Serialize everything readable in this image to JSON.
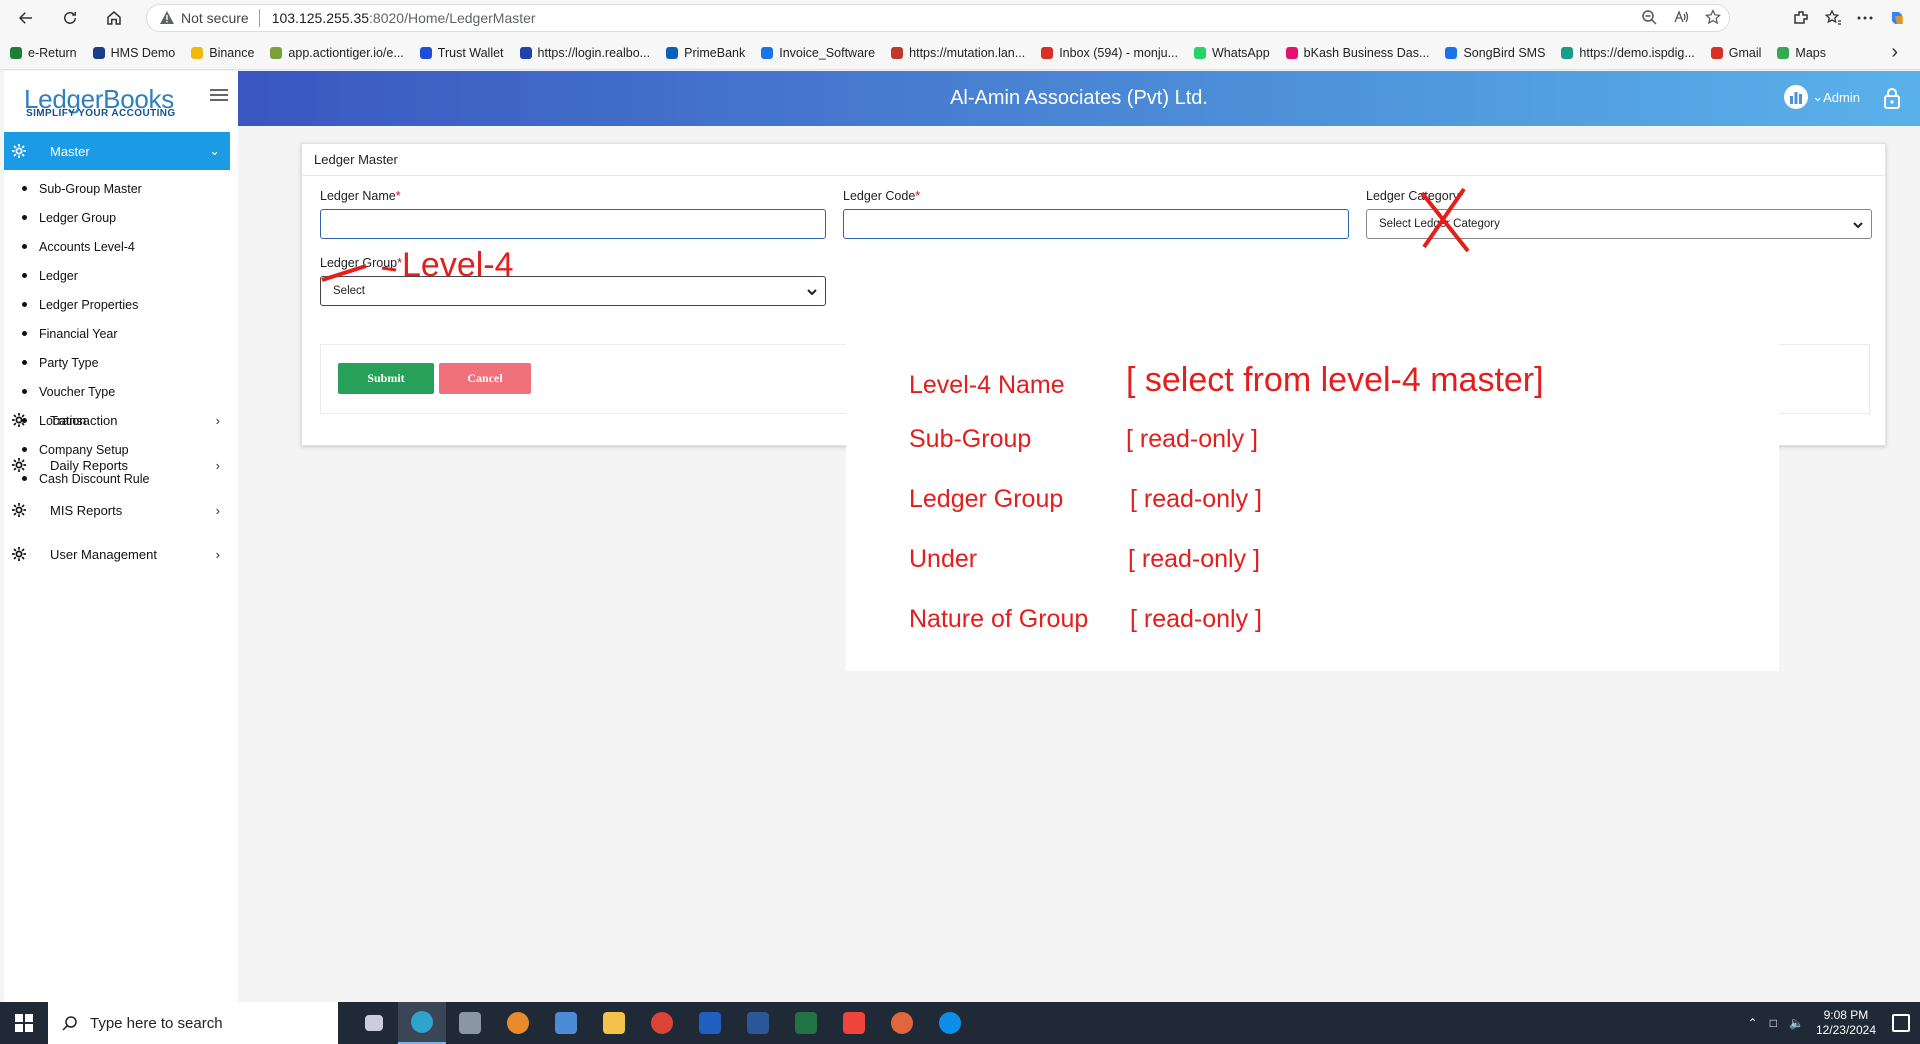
{
  "browser": {
    "security_label": "Not secure",
    "url_host": "103.125.255.35",
    "url_path": ":8020/Home/LedgerMaster",
    "bookmarks": [
      {
        "label": "e-Return",
        "color": "#1e7e34"
      },
      {
        "label": "HMS Demo",
        "color": "#1a3f8a"
      },
      {
        "label": "Binance",
        "color": "#f0b90b"
      },
      {
        "label": "app.actiontiger.io/e...",
        "color": "#7aa03a"
      },
      {
        "label": "Trust Wallet",
        "color": "#1d4ed8"
      },
      {
        "label": "https://login.realbo...",
        "color": "#2143a8"
      },
      {
        "label": "PrimeBank",
        "color": "#0a5fb8"
      },
      {
        "label": "Invoice_Software",
        "color": "#1a73e8"
      },
      {
        "label": "https://mutation.lan...",
        "color": "#c0392b"
      },
      {
        "label": "Inbox (594) - monju...",
        "color": "#d93025"
      },
      {
        "label": "WhatsApp",
        "color": "#25d366"
      },
      {
        "label": "bKash Business Das...",
        "color": "#e2136e"
      },
      {
        "label": "SongBird SMS",
        "color": "#1a73e8"
      },
      {
        "label": "https://demo.ispdig...",
        "color": "#1a9c8a"
      },
      {
        "label": "Gmail",
        "color": "#d93025"
      },
      {
        "label": "Maps",
        "color": "#34a853"
      }
    ]
  },
  "app": {
    "brand_name": "LedgerBooks",
    "brand_tagline": "SIMPLIFY YOUR ACCOUTING",
    "company_name": "Al-Amin Associates (Pvt) Ltd.",
    "user_label": "Admin",
    "accent_color": "#1b9ae6"
  },
  "sidebar": {
    "active_menu": "Master",
    "master_items": [
      "Sub-Group Master",
      "Ledger Group",
      "Accounts Level-4",
      "Ledger",
      "Ledger Properties",
      "Financial Year",
      "Party Type",
      "Voucher Type",
      "Location",
      "Company Setup",
      "Cash Discount Rule"
    ],
    "other_menus": [
      "Transaction",
      "Daily Reports",
      "MIS Reports",
      "User Management"
    ]
  },
  "form": {
    "title": "Ledger Master",
    "ledger_name_label": "Ledger Name",
    "ledger_code_label": "Ledger Code",
    "ledger_category_label": "Ledger Category",
    "ledger_category_placeholder": "Select Ledger Category",
    "ledger_group_label": "Ledger Group",
    "ledger_group_value": "Select",
    "required_mark": "*",
    "submit_label": "Submit",
    "cancel_label": "Cancel"
  },
  "annotation": {
    "level4_label": "Level-4",
    "rows": [
      {
        "name": "Level-4 Name",
        "value": "[ select from level-4 master]"
      },
      {
        "name": "Sub-Group",
        "value": "[  read-only  ]"
      },
      {
        "name": "Ledger Group",
        "value": "[  read-only  ]"
      },
      {
        "name": "Under",
        "value": "[  read-only ]"
      },
      {
        "name": "Nature of Group",
        "value": "[  read-only ]"
      }
    ]
  },
  "taskbar": {
    "search_placeholder": "Type here to search",
    "time": "9:08 PM",
    "date": "12/23/2024"
  }
}
